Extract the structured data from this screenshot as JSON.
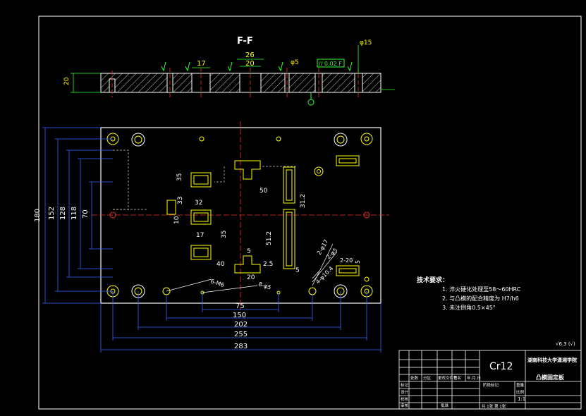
{
  "section": {
    "title": "F-F",
    "thickness_dim": "20",
    "dims": [
      "17",
      "26",
      "20",
      "φ5",
      "φ15"
    ],
    "tolerance": "// 0.02 F",
    "datum": "F"
  },
  "plan": {
    "horizontal_dims": [
      "75",
      "150",
      "202",
      "255",
      "283"
    ],
    "vertical_dims": [
      "180",
      "152",
      "128",
      "118",
      "70"
    ],
    "inner_dims": [
      "50",
      "32",
      "17",
      "10",
      "35",
      "31.2",
      "51.2",
      "40",
      "20",
      "5",
      "2.5",
      "5",
      "35",
      "33"
    ],
    "hole_notes": [
      "6-M6",
      "8-φ5",
      "2-φ17",
      "2-φ5",
      "4-φ10.4",
      "2-20",
      "5"
    ]
  },
  "notes": {
    "heading": "技术要求：",
    "items": [
      "1.  淬火硬化处理至58〜60HRC",
      "2.  与凸模的配合精度为 H7/h6",
      "3.  未注倒角0.5×45°"
    ]
  },
  "roughness": "√6.3 (√)",
  "title_block": {
    "material": "Cr12",
    "school": "湖南科技大学潇湘学院",
    "drawing_name": "凸模固定板",
    "scale": "1:1",
    "sheet": "共 1张 第 1张",
    "row_labels": [
      "标记",
      "设计",
      "校核",
      "审核",
      "工艺"
    ],
    "col_labels": [
      "处数",
      "分区",
      "更改文件号",
      "签名",
      "年.月.日"
    ],
    "extra": [
      "阶段标记",
      "重量",
      "比例",
      "批准"
    ]
  }
}
